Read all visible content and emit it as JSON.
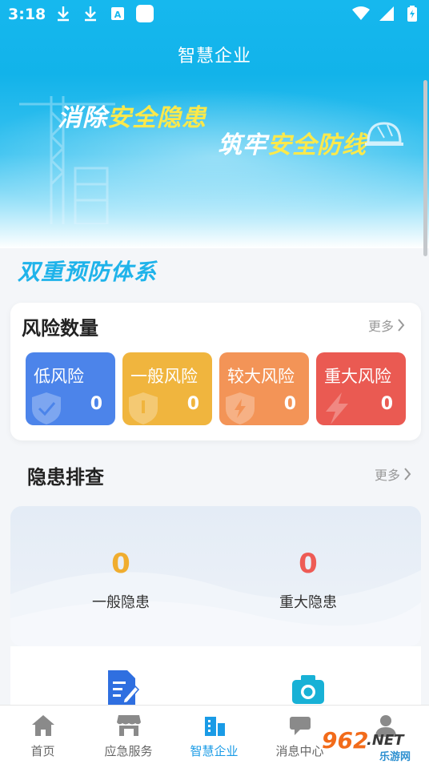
{
  "status_bar": {
    "time": "3:18"
  },
  "header": {
    "title": "智慧企业"
  },
  "banner": {
    "line1_a": "消除",
    "line1_b": "安全隐患",
    "line2_a": "筑牢",
    "line2_b": "安全防线"
  },
  "section": {
    "title": "双重预防体系"
  },
  "risk": {
    "title": "风险数量",
    "more": "更多",
    "tiles": [
      {
        "label": "低风险",
        "value": "0",
        "color": "#4c84ea"
      },
      {
        "label": "一般风险",
        "value": "0",
        "color": "#f0b53e"
      },
      {
        "label": "较大风险",
        "value": "0",
        "color": "#f39457"
      },
      {
        "label": "重大风险",
        "value": "0",
        "color": "#ea5a52"
      }
    ]
  },
  "hazard": {
    "title": "隐患排查",
    "more": "更多",
    "general_value": "0",
    "general_label": "一般隐患",
    "general_color": "#f0ad2f",
    "major_value": "0",
    "major_label": "重大隐患",
    "major_color": "#ee5b55"
  },
  "tabbar": {
    "items": [
      {
        "label": "首页",
        "icon": "home-icon"
      },
      {
        "label": "应急服务",
        "icon": "store-icon"
      },
      {
        "label": "智慧企业",
        "icon": "building-icon"
      },
      {
        "label": "消息中心",
        "icon": "chat-icon"
      },
      {
        "label": "",
        "icon": "user-icon"
      }
    ],
    "active_color": "#1a9be6"
  },
  "watermark": {
    "main": "962",
    "suffix": ".NET",
    "sub": "乐游网"
  }
}
